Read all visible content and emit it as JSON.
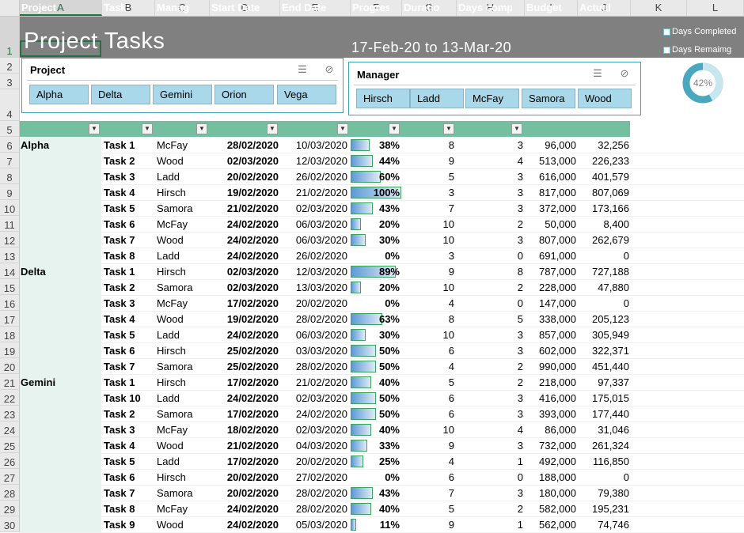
{
  "columns": [
    "A",
    "B",
    "C",
    "D",
    "E",
    "F",
    "G",
    "H",
    "I",
    "J",
    "K",
    "L"
  ],
  "rows": [
    "1",
    "2",
    "3",
    "4",
    "5",
    "6",
    "7",
    "8",
    "9",
    "10",
    "11",
    "12",
    "13",
    "14",
    "15",
    "16",
    "17",
    "18",
    "19",
    "20",
    "21",
    "22",
    "23",
    "24",
    "25",
    "26",
    "27",
    "28",
    "29",
    "30"
  ],
  "banner": {
    "title": "Project Tasks",
    "date_range": "17-Feb-20 to 13-Mar-20",
    "legend_completed": "Days Completed",
    "legend_remaining": "Days Remaimg",
    "donut_label": "42%",
    "donut_fraction": 0.42
  },
  "slicers": {
    "project": {
      "title": "Project",
      "items": [
        "Alpha",
        "Delta",
        "Gemini",
        "Orion",
        "Vega"
      ]
    },
    "manager": {
      "title": "Manager",
      "items": [
        "Hirsch",
        "Ladd",
        "McFay",
        "Samora",
        "Wood"
      ]
    }
  },
  "table": {
    "headers": [
      "Project",
      "Task",
      "Manag",
      "Start Date",
      "End Date",
      "Progres",
      "Duratio",
      "Days comp",
      "Budget",
      "Actual"
    ],
    "rows": [
      {
        "project": "Alpha",
        "task": "Task 1",
        "manager": "McFay",
        "start": "28/02/2020",
        "end": "10/03/2020",
        "progress": "38%",
        "pct": 0.38,
        "duration": "8",
        "days": "3",
        "budget": "96,000",
        "actual": "32,256"
      },
      {
        "project": "",
        "task": "Task 2",
        "manager": "Wood",
        "start": "02/03/2020",
        "end": "12/03/2020",
        "progress": "44%",
        "pct": 0.44,
        "duration": "9",
        "days": "4",
        "budget": "513,000",
        "actual": "226,233"
      },
      {
        "project": "",
        "task": "Task 3",
        "manager": "Ladd",
        "start": "20/02/2020",
        "end": "26/02/2020",
        "progress": "60%",
        "pct": 0.6,
        "duration": "5",
        "days": "3",
        "budget": "616,000",
        "actual": "401,579"
      },
      {
        "project": "",
        "task": "Task 4",
        "manager": "Hirsch",
        "start": "19/02/2020",
        "end": "21/02/2020",
        "progress": "100%",
        "pct": 1.0,
        "duration": "3",
        "days": "3",
        "budget": "817,000",
        "actual": "807,069"
      },
      {
        "project": "",
        "task": "Task 5",
        "manager": "Samora",
        "start": "21/02/2020",
        "end": "02/03/2020",
        "progress": "43%",
        "pct": 0.43,
        "duration": "7",
        "days": "3",
        "budget": "372,000",
        "actual": "173,166"
      },
      {
        "project": "",
        "task": "Task 6",
        "manager": "McFay",
        "start": "24/02/2020",
        "end": "06/03/2020",
        "progress": "20%",
        "pct": 0.2,
        "duration": "10",
        "days": "2",
        "budget": "50,000",
        "actual": "8,400"
      },
      {
        "project": "",
        "task": "Task 7",
        "manager": "Wood",
        "start": "24/02/2020",
        "end": "06/03/2020",
        "progress": "30%",
        "pct": 0.3,
        "duration": "10",
        "days": "3",
        "budget": "807,000",
        "actual": "262,679"
      },
      {
        "project": "",
        "task": "Task 8",
        "manager": "Ladd",
        "start": "24/02/2020",
        "end": "26/02/2020",
        "progress": "0%",
        "pct": 0,
        "duration": "3",
        "days": "0",
        "budget": "691,000",
        "actual": "0"
      },
      {
        "project": "Delta",
        "task": "Task 1",
        "manager": "Hirsch",
        "start": "02/03/2020",
        "end": "12/03/2020",
        "progress": "89%",
        "pct": 0.89,
        "duration": "9",
        "days": "8",
        "budget": "787,000",
        "actual": "727,188"
      },
      {
        "project": "",
        "task": "Task 2",
        "manager": "Samora",
        "start": "02/03/2020",
        "end": "13/03/2020",
        "progress": "20%",
        "pct": 0.2,
        "duration": "10",
        "days": "2",
        "budget": "228,000",
        "actual": "47,880"
      },
      {
        "project": "",
        "task": "Task 3",
        "manager": "McFay",
        "start": "17/02/2020",
        "end": "20/02/2020",
        "progress": "0%",
        "pct": 0,
        "duration": "4",
        "days": "0",
        "budget": "147,000",
        "actual": "0"
      },
      {
        "project": "",
        "task": "Task 4",
        "manager": "Wood",
        "start": "19/02/2020",
        "end": "28/02/2020",
        "progress": "63%",
        "pct": 0.63,
        "duration": "8",
        "days": "5",
        "budget": "338,000",
        "actual": "205,123"
      },
      {
        "project": "",
        "task": "Task 5",
        "manager": "Ladd",
        "start": "24/02/2020",
        "end": "06/03/2020",
        "progress": "30%",
        "pct": 0.3,
        "duration": "10",
        "days": "3",
        "budget": "857,000",
        "actual": "305,949"
      },
      {
        "project": "",
        "task": "Task 6",
        "manager": "Hirsch",
        "start": "25/02/2020",
        "end": "03/03/2020",
        "progress": "50%",
        "pct": 0.5,
        "duration": "6",
        "days": "3",
        "budget": "602,000",
        "actual": "322,371"
      },
      {
        "project": "",
        "task": "Task 7",
        "manager": "Samora",
        "start": "25/02/2020",
        "end": "28/02/2020",
        "progress": "50%",
        "pct": 0.5,
        "duration": "4",
        "days": "2",
        "budget": "990,000",
        "actual": "451,440"
      },
      {
        "project": "Gemini",
        "task": "Task 1",
        "manager": "Hirsch",
        "start": "17/02/2020",
        "end": "21/02/2020",
        "progress": "40%",
        "pct": 0.4,
        "duration": "5",
        "days": "2",
        "budget": "218,000",
        "actual": "97,337"
      },
      {
        "project": "",
        "task": "Task 10",
        "manager": "Ladd",
        "start": "24/02/2020",
        "end": "02/03/2020",
        "progress": "50%",
        "pct": 0.5,
        "duration": "6",
        "days": "3",
        "budget": "416,000",
        "actual": "175,015"
      },
      {
        "project": "",
        "task": "Task 2",
        "manager": "Samora",
        "start": "17/02/2020",
        "end": "24/02/2020",
        "progress": "50%",
        "pct": 0.5,
        "duration": "6",
        "days": "3",
        "budget": "393,000",
        "actual": "177,440"
      },
      {
        "project": "",
        "task": "Task 3",
        "manager": "McFay",
        "start": "18/02/2020",
        "end": "02/03/2020",
        "progress": "40%",
        "pct": 0.4,
        "duration": "10",
        "days": "4",
        "budget": "86,000",
        "actual": "31,046"
      },
      {
        "project": "",
        "task": "Task 4",
        "manager": "Wood",
        "start": "21/02/2020",
        "end": "04/03/2020",
        "progress": "33%",
        "pct": 0.33,
        "duration": "9",
        "days": "3",
        "budget": "732,000",
        "actual": "261,324"
      },
      {
        "project": "",
        "task": "Task 5",
        "manager": "Ladd",
        "start": "17/02/2020",
        "end": "20/02/2020",
        "progress": "25%",
        "pct": 0.25,
        "duration": "4",
        "days": "1",
        "budget": "492,000",
        "actual": "116,850"
      },
      {
        "project": "",
        "task": "Task 6",
        "manager": "Hirsch",
        "start": "20/02/2020",
        "end": "27/02/2020",
        "progress": "0%",
        "pct": 0,
        "duration": "6",
        "days": "0",
        "budget": "188,000",
        "actual": "0"
      },
      {
        "project": "",
        "task": "Task 7",
        "manager": "Samora",
        "start": "20/02/2020",
        "end": "28/02/2020",
        "progress": "43%",
        "pct": 0.43,
        "duration": "7",
        "days": "3",
        "budget": "180,000",
        "actual": "79,380"
      },
      {
        "project": "",
        "task": "Task 8",
        "manager": "McFay",
        "start": "24/02/2020",
        "end": "28/02/2020",
        "progress": "40%",
        "pct": 0.4,
        "duration": "5",
        "days": "2",
        "budget": "582,000",
        "actual": "195,231"
      },
      {
        "project": "",
        "task": "Task 9",
        "manager": "Wood",
        "start": "24/02/2020",
        "end": "05/03/2020",
        "progress": "11%",
        "pct": 0.11,
        "duration": "9",
        "days": "1",
        "budget": "562,000",
        "actual": "74,746"
      }
    ]
  }
}
